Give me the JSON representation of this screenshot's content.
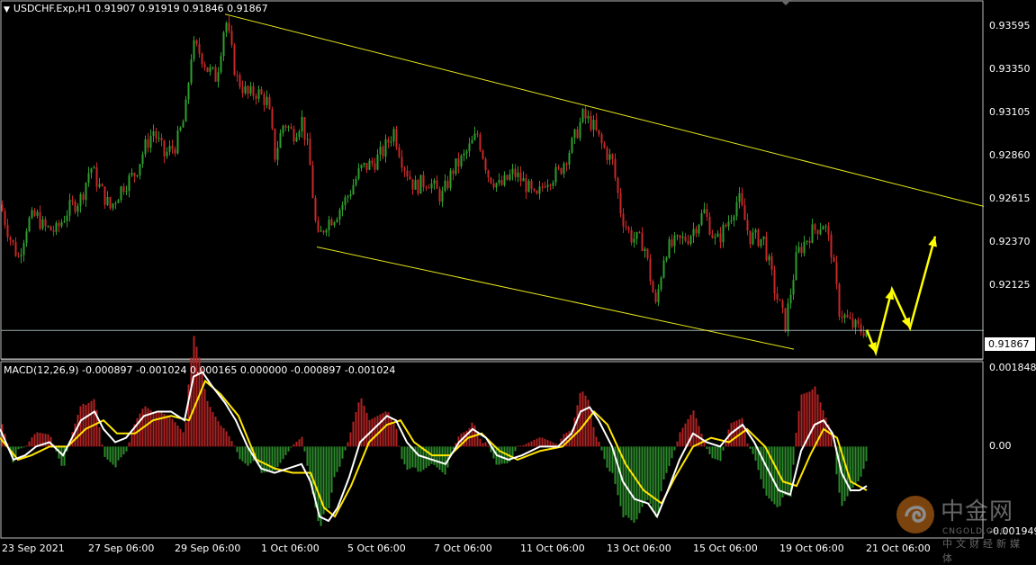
{
  "main_header": "USDCHF.Exp,H1  0.91907 0.91919 0.91846 0.91867",
  "macd_header": "MACD(12,26,9) -0.000897 -0.001024 0.000165 0.000000 -0.000897 -0.001024",
  "price_label": "0.91867",
  "logo": {
    "name": "中金网",
    "sub": "CNGOLD.ORG",
    "sub2": "中文财经新媒体"
  },
  "colors": {
    "background": "#000000",
    "bull": "#2e9e2e",
    "bear": "#c62828",
    "trendline": "#e6e619",
    "macd_line": "#ffffff",
    "signal_line": "#ffe600",
    "arrow": "#ffff00"
  },
  "chart_data": [
    {
      "type": "candlestick",
      "title": "USDCHF.Exp,H1",
      "ylim": [
        0.9172,
        0.9372
      ],
      "y_ticks": [
        "0.93595",
        "0.93350",
        "0.93105",
        "0.92860",
        "0.92615",
        "0.92370",
        "0.92125",
        "0.91867"
      ],
      "y_tick_values": [
        0.93595,
        0.9335,
        0.93105,
        0.9286,
        0.92615,
        0.9237,
        0.92125,
        0.91867
      ],
      "x_ticks": [
        "23 Sep 2021",
        "27 Sep 06:00",
        "29 Sep 06:00",
        "1 Oct 06:00",
        "5 Oct 06:00",
        "7 Oct 06:00",
        "11 Oct 06:00",
        "13 Oct 06:00",
        "15 Oct 06:00",
        "19 Oct 06:00",
        "21 Oct 06:00"
      ],
      "ohlc_last": {
        "open": 0.91907,
        "high": 0.91919,
        "low": 0.91846,
        "close": 0.91867
      },
      "close_path": [
        [
          0,
          0.9258
        ],
        [
          10,
          0.924
        ],
        [
          20,
          0.9228
        ],
        [
          30,
          0.9248
        ],
        [
          40,
          0.9252
        ],
        [
          48,
          0.9245
        ],
        [
          62,
          0.9243
        ],
        [
          75,
          0.9255
        ],
        [
          90,
          0.9262
        ],
        [
          100,
          0.928
        ],
        [
          110,
          0.9268
        ],
        [
          122,
          0.9256
        ],
        [
          135,
          0.9268
        ],
        [
          150,
          0.9276
        ],
        [
          160,
          0.929
        ],
        [
          170,
          0.93
        ],
        [
          182,
          0.9286
        ],
        [
          195,
          0.9292
        ],
        [
          205,
          0.9308
        ],
        [
          213,
          0.9348
        ],
        [
          222,
          0.9344
        ],
        [
          230,
          0.9335
        ],
        [
          240,
          0.933
        ],
        [
          250,
          0.9364
        ],
        [
          262,
          0.933
        ],
        [
          275,
          0.932
        ],
        [
          285,
          0.9322
        ],
        [
          297,
          0.9316
        ],
        [
          305,
          0.9286
        ],
        [
          315,
          0.9305
        ],
        [
          325,
          0.9298
        ],
        [
          335,
          0.9306
        ],
        [
          343,
          0.9285
        ],
        [
          352,
          0.9237
        ],
        [
          362,
          0.9248
        ],
        [
          372,
          0.9252
        ],
        [
          385,
          0.9262
        ],
        [
          400,
          0.9278
        ],
        [
          415,
          0.9282
        ],
        [
          425,
          0.9288
        ],
        [
          437,
          0.93
        ],
        [
          447,
          0.9282
        ],
        [
          460,
          0.9268
        ],
        [
          475,
          0.9272
        ],
        [
          490,
          0.9262
        ],
        [
          503,
          0.9278
        ],
        [
          515,
          0.9285
        ],
        [
          530,
          0.9298
        ],
        [
          542,
          0.9275
        ],
        [
          555,
          0.9268
        ],
        [
          570,
          0.9276
        ],
        [
          583,
          0.927
        ],
        [
          595,
          0.926
        ],
        [
          605,
          0.9272
        ],
        [
          620,
          0.9276
        ],
        [
          635,
          0.9292
        ],
        [
          647,
          0.9308
        ],
        [
          657,
          0.9304
        ],
        [
          668,
          0.9292
        ],
        [
          680,
          0.9282
        ],
        [
          690,
          0.9252
        ],
        [
          700,
          0.924
        ],
        [
          715,
          0.9236
        ],
        [
          728,
          0.92
        ],
        [
          738,
          0.9232
        ],
        [
          750,
          0.9236
        ],
        [
          765,
          0.924
        ],
        [
          782,
          0.9254
        ],
        [
          795,
          0.9236
        ],
        [
          808,
          0.9248
        ],
        [
          820,
          0.9262
        ],
        [
          832,
          0.924
        ],
        [
          848,
          0.9238
        ],
        [
          860,
          0.921
        ],
        [
          872,
          0.919
        ],
        [
          885,
          0.923
        ],
        [
          900,
          0.9242
        ],
        [
          915,
          0.9248
        ],
        [
          923,
          0.9232
        ],
        [
          932,
          0.9198
        ],
        [
          945,
          0.919
        ],
        [
          955,
          0.9187
        ],
        [
          963,
          0.9187
        ]
      ],
      "trendlines": [
        {
          "name": "upper",
          "from": [
            250,
            0.9366
          ],
          "to": [
            1093,
            0.9257
          ]
        },
        {
          "name": "lower",
          "from": [
            352,
            0.9234
          ],
          "to": [
            882,
            0.9176
          ]
        }
      ],
      "projection_arrow": [
        [
          963,
          0.9187
        ],
        [
          973,
          0.9174
        ],
        [
          991,
          0.921
        ],
        [
          1011,
          0.9188
        ],
        [
          1039,
          0.924
        ]
      ],
      "current_price_line": 0.91867
    },
    {
      "type": "macd",
      "title": "MACD(12,26,9)",
      "values": {
        "macd": -0.000897,
        "signal": -0.001024,
        "histogram": 0.000165
      },
      "ylim": [
        -0.00205,
        0.0019
      ],
      "y_ticks": [
        "0.001848",
        "0.00",
        "-0.001949"
      ],
      "y_tick_values": [
        0.001848,
        0,
        -0.001949
      ],
      "macd_path": [
        [
          0,
          0.0004
        ],
        [
          15,
          -0.0003
        ],
        [
          28,
          -0.0002
        ],
        [
          40,
          0.0
        ],
        [
          55,
          0.0001
        ],
        [
          70,
          -0.0002
        ],
        [
          90,
          0.0006
        ],
        [
          105,
          0.0008
        ],
        [
          115,
          0.0004
        ],
        [
          128,
          0.0001
        ],
        [
          140,
          0.0002
        ],
        [
          160,
          0.0007
        ],
        [
          175,
          0.0008
        ],
        [
          190,
          0.0008
        ],
        [
          205,
          0.0006
        ],
        [
          215,
          0.0016
        ],
        [
          225,
          0.0017
        ],
        [
          235,
          0.0014
        ],
        [
          250,
          0.001
        ],
        [
          262,
          0.0006
        ],
        [
          275,
          0.0
        ],
        [
          290,
          -0.0005
        ],
        [
          305,
          -0.0006
        ],
        [
          320,
          -0.0005
        ],
        [
          335,
          -0.0004
        ],
        [
          345,
          -0.0008
        ],
        [
          355,
          -0.0016
        ],
        [
          365,
          -0.0017
        ],
        [
          375,
          -0.0014
        ],
        [
          388,
          -0.0007
        ],
        [
          400,
          0.0001
        ],
        [
          415,
          0.0004
        ],
        [
          430,
          0.0007
        ],
        [
          440,
          0.0006
        ],
        [
          452,
          0.0001
        ],
        [
          465,
          -0.0002
        ],
        [
          480,
          -0.0003
        ],
        [
          495,
          -0.0004
        ],
        [
          510,
          0.0001
        ],
        [
          525,
          0.0004
        ],
        [
          540,
          0.0002
        ],
        [
          552,
          -0.0002
        ],
        [
          565,
          -0.0003
        ],
        [
          580,
          -0.0002
        ],
        [
          600,
          0.0
        ],
        [
          620,
          0.0
        ],
        [
          635,
          0.0003
        ],
        [
          645,
          0.0008
        ],
        [
          655,
          0.0009
        ],
        [
          665,
          0.0006
        ],
        [
          680,
          0.0
        ],
        [
          692,
          -0.0008
        ],
        [
          705,
          -0.0012
        ],
        [
          720,
          -0.0013
        ],
        [
          730,
          -0.0016
        ],
        [
          742,
          -0.001
        ],
        [
          755,
          -0.0003
        ],
        [
          770,
          0.0003
        ],
        [
          785,
          0.0001
        ],
        [
          800,
          0.0
        ],
        [
          812,
          0.0003
        ],
        [
          825,
          0.0005
        ],
        [
          838,
          0.0001
        ],
        [
          850,
          -0.0004
        ],
        [
          865,
          -0.001
        ],
        [
          878,
          -0.0011
        ],
        [
          890,
          -0.0001
        ],
        [
          905,
          0.0005
        ],
        [
          915,
          0.0006
        ],
        [
          925,
          0.0003
        ],
        [
          935,
          -0.0006
        ],
        [
          945,
          -0.001
        ],
        [
          955,
          -0.001
        ],
        [
          963,
          -0.0009
        ]
      ],
      "signal_path": [
        [
          0,
          0.0002
        ],
        [
          20,
          -0.0003
        ],
        [
          35,
          -0.0002
        ],
        [
          55,
          0.0
        ],
        [
          75,
          0.0
        ],
        [
          95,
          0.0004
        ],
        [
          115,
          0.0006
        ],
        [
          130,
          0.0003
        ],
        [
          150,
          0.0003
        ],
        [
          170,
          0.0006
        ],
        [
          190,
          0.0007
        ],
        [
          210,
          0.0006
        ],
        [
          228,
          0.0015
        ],
        [
          245,
          0.0012
        ],
        [
          265,
          0.0007
        ],
        [
          285,
          -0.0003
        ],
        [
          305,
          -0.0005
        ],
        [
          325,
          -0.0006
        ],
        [
          345,
          -0.0006
        ],
        [
          360,
          -0.0014
        ],
        [
          372,
          -0.0016
        ],
        [
          390,
          -0.0009
        ],
        [
          410,
          0.0001
        ],
        [
          430,
          0.0005
        ],
        [
          445,
          0.0006
        ],
        [
          460,
          0.0001
        ],
        [
          480,
          -0.0002
        ],
        [
          500,
          -0.0002
        ],
        [
          520,
          0.0002
        ],
        [
          535,
          0.0003
        ],
        [
          555,
          -0.0001
        ],
        [
          575,
          -0.0003
        ],
        [
          600,
          -0.0001
        ],
        [
          625,
          0.0
        ],
        [
          645,
          0.0004
        ],
        [
          660,
          0.0008
        ],
        [
          675,
          0.0005
        ],
        [
          695,
          -0.0004
        ],
        [
          715,
          -0.001
        ],
        [
          735,
          -0.0013
        ],
        [
          750,
          -0.0007
        ],
        [
          770,
          0.0
        ],
        [
          790,
          0.0002
        ],
        [
          810,
          0.0001
        ],
        [
          830,
          0.0004
        ],
        [
          850,
          0.0
        ],
        [
          870,
          -0.0008
        ],
        [
          885,
          -0.0009
        ],
        [
          900,
          -0.0002
        ],
        [
          915,
          0.0004
        ],
        [
          930,
          0.0002
        ],
        [
          945,
          -0.0008
        ],
        [
          963,
          -0.001
        ]
      ]
    }
  ]
}
